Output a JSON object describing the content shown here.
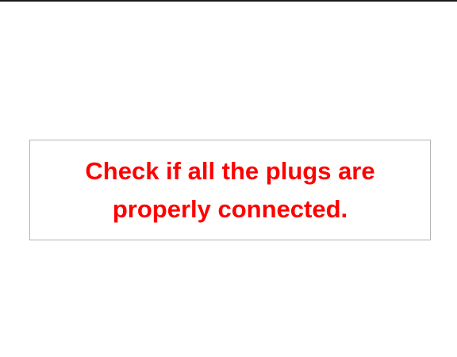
{
  "message": {
    "text": "Check if all the plugs are properly connected.",
    "color": "#ff0000"
  },
  "colors": {
    "background": "#ffffff",
    "box_border": "#b3b3b3",
    "top_rule": "#1a1a1a"
  }
}
